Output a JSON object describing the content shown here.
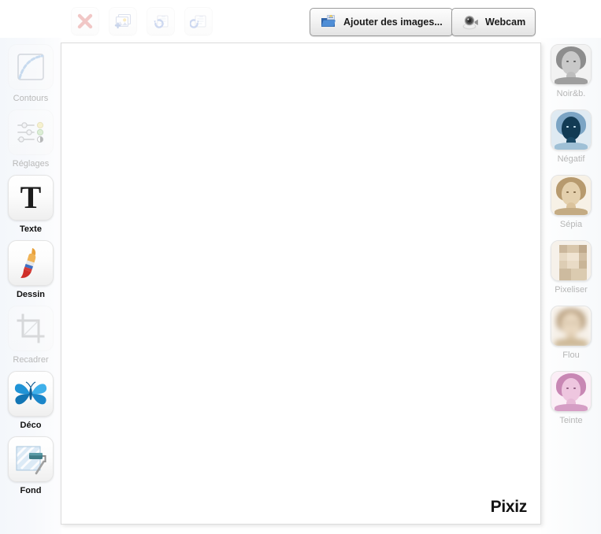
{
  "app": {
    "name": "Pixiz",
    "watermark": "Pixiz"
  },
  "toolbar": {
    "icon_buttons": [
      {
        "name": "clear-button",
        "icon": "red-cross-icon",
        "label": "",
        "enabled": false
      },
      {
        "name": "add-image-button",
        "icon": "add-photo-icon",
        "label": "",
        "enabled": false
      },
      {
        "name": "undo-button",
        "icon": "undo-arrow-icon",
        "label": "",
        "enabled": false
      },
      {
        "name": "redo-button",
        "icon": "redo-arrow-icon",
        "label": "",
        "enabled": false
      }
    ],
    "add_images": {
      "label": "Ajouter des images...",
      "icon": "open-folder-icon"
    },
    "webcam": {
      "label": "Webcam",
      "icon": "webcam-icon"
    }
  },
  "left_tools": [
    {
      "label": "Contours",
      "icon": "curve-outline-icon",
      "enabled": false
    },
    {
      "label": "Réglages",
      "icon": "sliders-icon",
      "enabled": false
    },
    {
      "label": "Texte",
      "icon": "text-t-icon",
      "enabled": true
    },
    {
      "label": "Dessin",
      "icon": "paint-brush-icon",
      "enabled": true
    },
    {
      "label": "Recadrer",
      "icon": "crop-icon",
      "enabled": false
    },
    {
      "label": "Déco",
      "icon": "butterfly-icon",
      "enabled": true
    },
    {
      "label": "Fond",
      "icon": "paint-roller-icon",
      "enabled": true
    }
  ],
  "right_filters": [
    {
      "label": "Noir&b.",
      "icon": "filter-thumb-grayscale"
    },
    {
      "label": "Négatif",
      "icon": "filter-thumb-negative"
    },
    {
      "label": "Sépia",
      "icon": "filter-thumb-sepia"
    },
    {
      "label": "Pixeliser",
      "icon": "filter-thumb-pixelate"
    },
    {
      "label": "Flou",
      "icon": "filter-thumb-blur"
    },
    {
      "label": "Teinte",
      "icon": "filter-thumb-tint"
    }
  ],
  "canvas": {
    "state": "empty",
    "background": "#ffffff"
  },
  "colors": {
    "canvas_bg": "#ffffff",
    "page_bg": "#ffffff",
    "rail_wash": "#f4f7fb",
    "label_enabled": "#111111",
    "label_disabled": "#b9b9b9",
    "button_border": "#9a9a9a",
    "accent_red": "#d9534f",
    "accent_blue": "#2aa3d8"
  }
}
